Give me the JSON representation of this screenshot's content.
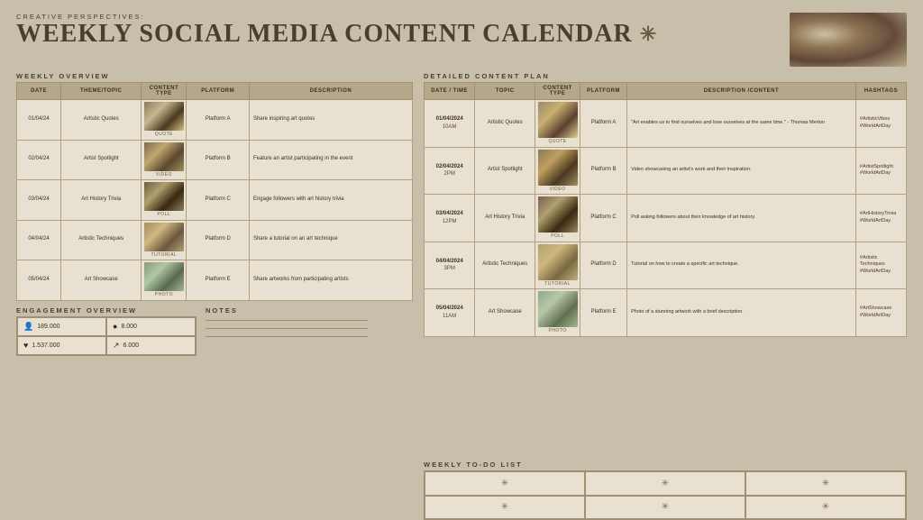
{
  "header": {
    "subtitle": "Creative Perspectives:",
    "title": "Weekly Social Media Content Calendar",
    "asterisk": "✳"
  },
  "weekly_overview": {
    "section_title": "Weekly Overview",
    "columns": [
      "Date",
      "Theme/Topic",
      "Content Type",
      "Platform",
      "Description"
    ],
    "rows": [
      {
        "date": "01/04/24",
        "theme": "Artistic Quotes",
        "content_type": "QUOTE",
        "img_class": "img-quote",
        "platform": "Platform A",
        "description": "Share inspiring art quotes"
      },
      {
        "date": "02/04/24",
        "theme": "Artist Spotlight",
        "content_type": "VIDEO",
        "img_class": "img-video",
        "platform": "Platform B",
        "description": "Feature an artist participating in the event"
      },
      {
        "date": "03/04/24",
        "theme": "Art History Trivia",
        "content_type": "POLL",
        "img_class": "img-poll",
        "platform": "Platform C",
        "description": "Engage followers with art history trivia"
      },
      {
        "date": "04/04/24",
        "theme": "Artistic Techniques",
        "content_type": "TUTORIAL",
        "img_class": "img-tutorial",
        "platform": "Platform D",
        "description": "Share a tutorial on an art technique"
      },
      {
        "date": "05/04/24",
        "theme": "Art Showcase",
        "content_type": "PHOTO",
        "img_class": "img-photo",
        "platform": "Platform E",
        "description": "Share artworks from participating artists"
      }
    ]
  },
  "detailed_plan": {
    "section_title": "Detailed Content Plan",
    "columns": [
      "Date / Time",
      "Topic",
      "Content Type",
      "Platform",
      "Description /Content",
      "Hashtags"
    ],
    "rows": [
      {
        "date": "01/04/2024",
        "time": "10AM",
        "topic": "Artistic Quotes",
        "content_type": "QUOTE",
        "img_class": "img-quote2",
        "platform": "Platform A",
        "description": "\"Art enables us to find ourselves and lose ourselves at the same time.\" - Thomas Merton",
        "hashtags": "#ArtisticVibes\n#WorldArtDay"
      },
      {
        "date": "02/04/2024",
        "time": "2PM",
        "topic": "Artist Spotlight",
        "content_type": "VIDEO",
        "img_class": "img-video2",
        "platform": "Platform B",
        "description": "Video showcasing an artist's work and their inspiration.",
        "hashtags": "#ArtistSpotlight\n#WorldArtDay"
      },
      {
        "date": "03/04/2024",
        "time": "12PM",
        "topic": "Art History Trivia",
        "content_type": "POLL",
        "img_class": "img-poll2",
        "platform": "Platform C",
        "description": "Poll asking followers about their knowledge of art history.",
        "hashtags": "#ArtHistoryTrivia\n#WorldArtDay"
      },
      {
        "date": "04/04/2024",
        "time": "3PM",
        "topic": "Artistic Techniques",
        "content_type": "TUTORIAL",
        "img_class": "img-tutorial2",
        "platform": "Platform D",
        "description": "Tutorial on how to create a specific art technique.",
        "hashtags": "#Artistic\nTechniques\n#WorldArtDay"
      },
      {
        "date": "05/04/2024",
        "time": "11AM",
        "topic": "Art Showcase",
        "content_type": "PHOTO",
        "img_class": "img-photo2",
        "platform": "Platform E",
        "description": "Photo of a stunning artwork with a brief description.",
        "hashtags": "#ArtShowcase\n#WorldArtDay"
      }
    ]
  },
  "engagement": {
    "section_title": "Engagement Overview",
    "cells": [
      {
        "icon": "👤",
        "value": "189.000"
      },
      {
        "icon": "●",
        "value": "8.000"
      },
      {
        "icon": "♥",
        "value": "1.537.000"
      },
      {
        "icon": "↗",
        "value": "6.000"
      }
    ]
  },
  "notes": {
    "section_title": "Notes",
    "lines": 3
  },
  "todo": {
    "section_title": "Weekly To-Do List",
    "asterisk": "✳"
  }
}
